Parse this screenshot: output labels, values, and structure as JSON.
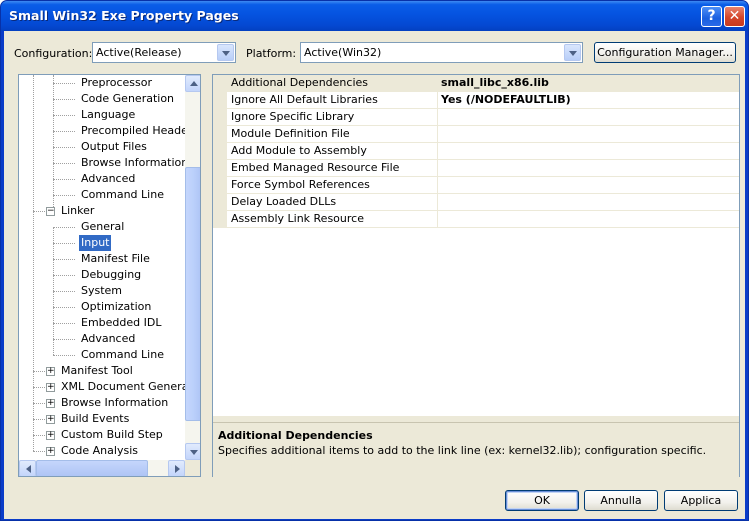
{
  "window": {
    "title": "Small Win32 Exe Property Pages",
    "help_glyph": "?",
    "close_glyph": "✕"
  },
  "toolbar": {
    "configuration_label": "Configuration:",
    "configuration_value": "Active(Release)",
    "platform_label": "Platform:",
    "platform_value": "Active(Win32)",
    "config_manager_label": "Configuration Manager..."
  },
  "tree": {
    "items": [
      {
        "label": "Preprocessor"
      },
      {
        "label": "Code Generation"
      },
      {
        "label": "Language"
      },
      {
        "label": "Precompiled Headers"
      },
      {
        "label": "Output Files"
      },
      {
        "label": "Browse Information"
      },
      {
        "label": "Advanced"
      },
      {
        "label": "Command Line"
      },
      {
        "label": "Linker",
        "expander": "−"
      },
      {
        "label": "General"
      },
      {
        "label": "Input",
        "selected": true
      },
      {
        "label": "Manifest File"
      },
      {
        "label": "Debugging"
      },
      {
        "label": "System"
      },
      {
        "label": "Optimization"
      },
      {
        "label": "Embedded IDL"
      },
      {
        "label": "Advanced"
      },
      {
        "label": "Command Line"
      },
      {
        "label": "Manifest Tool",
        "expander": "+"
      },
      {
        "label": "XML Document Generator",
        "expander": "+"
      },
      {
        "label": "Browse Information",
        "expander": "+"
      },
      {
        "label": "Build Events",
        "expander": "+"
      },
      {
        "label": "Custom Build Step",
        "expander": "+"
      },
      {
        "label": "Code Analysis",
        "expander": "+"
      }
    ]
  },
  "properties": {
    "rows": [
      {
        "name": "Additional Dependencies",
        "value": "small_libc_x86.lib",
        "selected": true
      },
      {
        "name": "Ignore All Default Libraries",
        "value": "Yes (/NODEFAULTLIB)"
      },
      {
        "name": "Ignore Specific Library",
        "value": ""
      },
      {
        "name": "Module Definition File",
        "value": ""
      },
      {
        "name": "Add Module to Assembly",
        "value": ""
      },
      {
        "name": "Embed Managed Resource File",
        "value": ""
      },
      {
        "name": "Force Symbol References",
        "value": ""
      },
      {
        "name": "Delay Loaded DLLs",
        "value": ""
      },
      {
        "name": "Assembly Link Resource",
        "value": ""
      }
    ],
    "description_title": "Additional Dependencies",
    "description_text": "Specifies additional items to add to the link line (ex: kernel32.lib); configuration specific."
  },
  "footer": {
    "ok_label": "OK",
    "cancel_label": "Annulla",
    "apply_label": "Applica"
  },
  "colors": {
    "titlebar": "#0553e0",
    "selection": "#316ac5",
    "dialog_bg": "#ece9d8"
  }
}
